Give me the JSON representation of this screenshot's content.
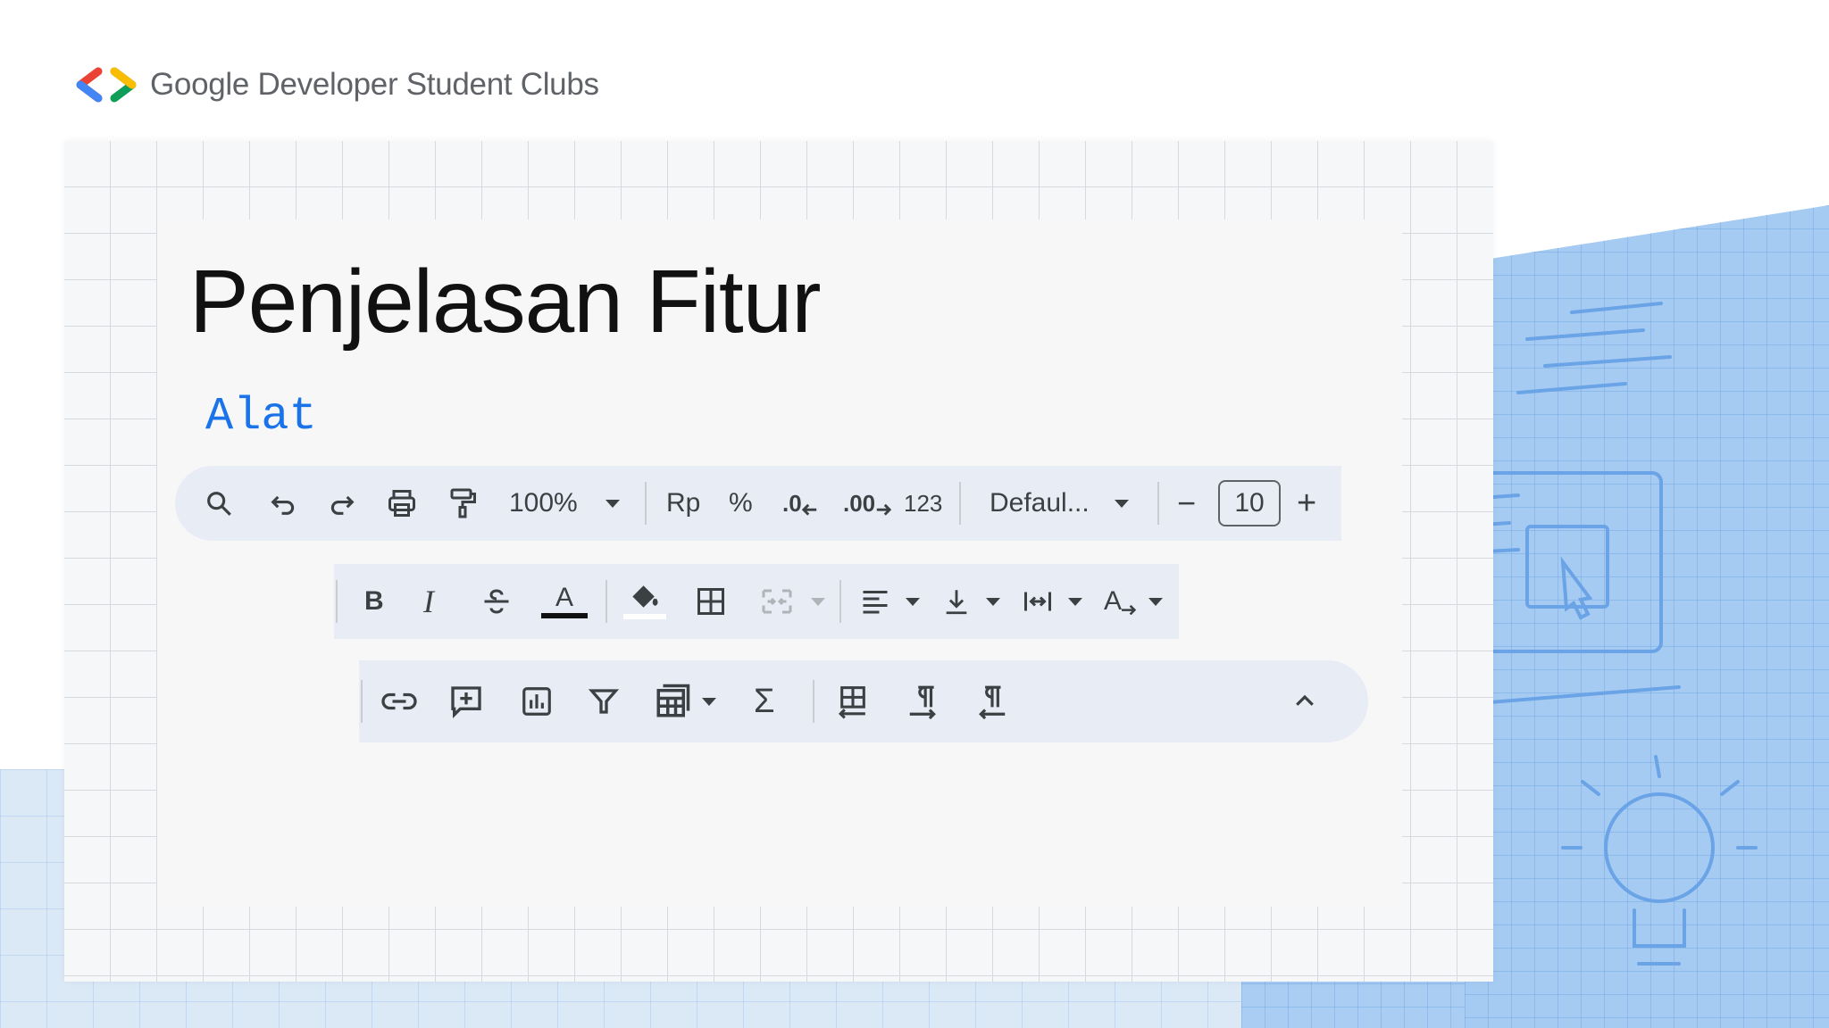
{
  "brand": {
    "name": "Google Developer Student Clubs"
  },
  "slide": {
    "title": "Penjelasan Fitur",
    "subtitle": "Alat"
  },
  "toolbar1": {
    "zoom": "100%",
    "currency": "Rp",
    "percent": "%",
    "decrease_decimal": ".0",
    "increase_decimal": ".00",
    "number_format": "123",
    "font": "Defaul...",
    "font_size": "10",
    "minus": "−",
    "plus": "+"
  },
  "toolbar2": {
    "bold": "B",
    "italic": "I",
    "text_color": "A",
    "rotate": "A"
  },
  "toolbar3": {
    "functions": "Σ"
  },
  "colors": {
    "accent": "#1a73e8",
    "toolbar_bg": "#e8ecf5",
    "blueprint": "#a6cbf2"
  },
  "icons": [
    "search-icon",
    "undo-icon",
    "redo-icon",
    "print-icon",
    "paint-format-icon",
    "borders-icon",
    "merge-cells-icon",
    "align-icon",
    "valign-icon",
    "wrap-icon",
    "text-rotation-icon",
    "link-icon",
    "comment-icon",
    "chart-icon",
    "filter-icon",
    "filter-views-icon",
    "functions-icon",
    "freeze-icon",
    "ltr-icon",
    "rtl-icon",
    "collapse-icon"
  ]
}
